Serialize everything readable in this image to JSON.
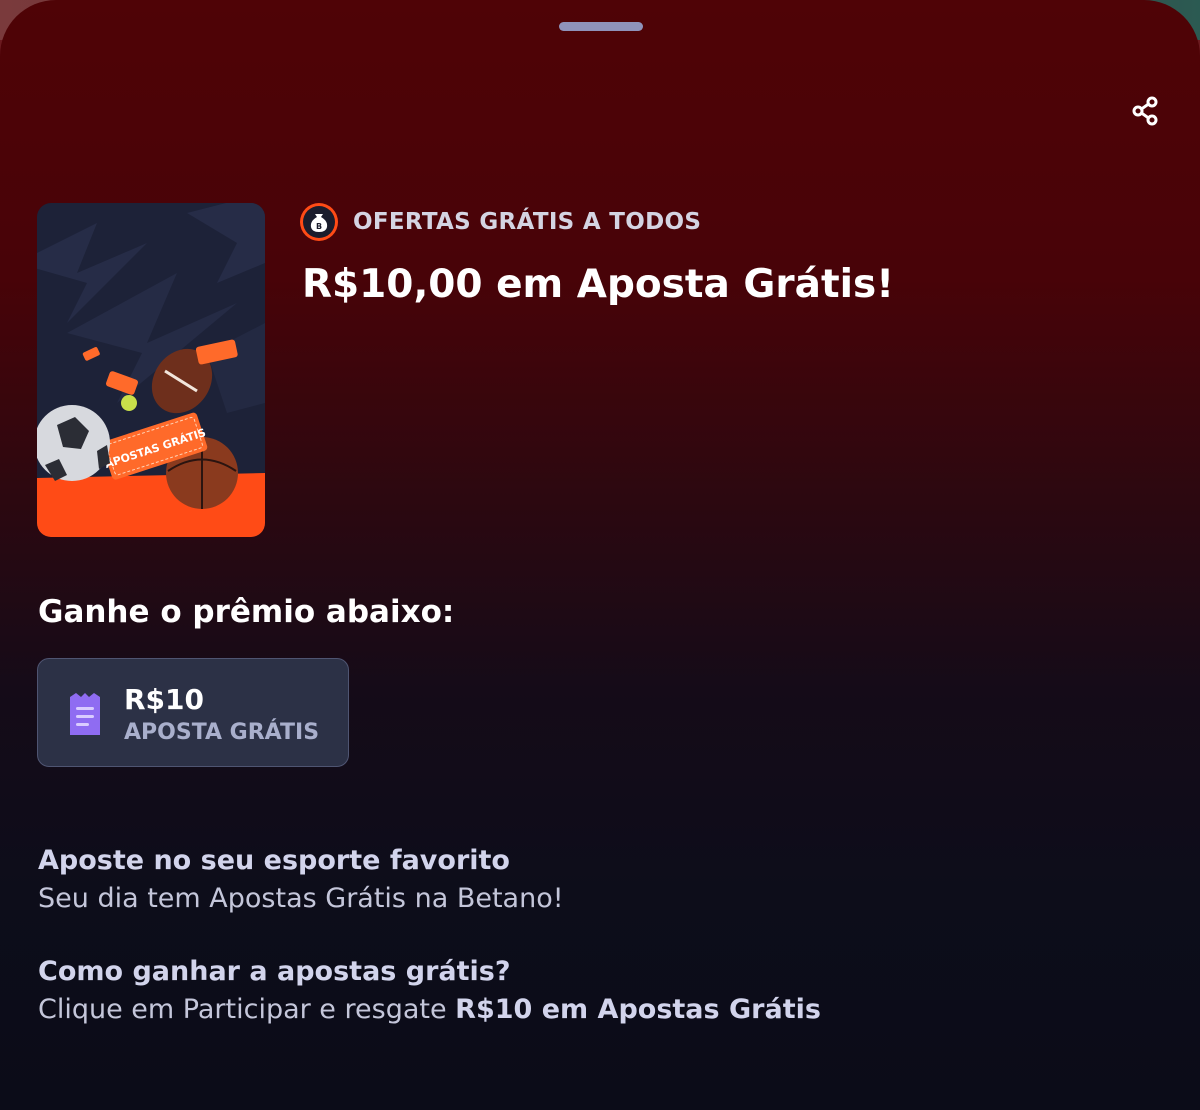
{
  "header": {
    "share_icon": "share-icon"
  },
  "offer": {
    "category_icon": "money-bag-icon",
    "category_label": "OFERTAS GRÁTIS A TODOS",
    "title": "R$10,00 em Aposta Grátis!",
    "image_caption": "APOSTAS GRÁTIS"
  },
  "prize": {
    "heading": "Ganhe o prêmio abaixo:",
    "icon": "bet-slip-icon",
    "amount": "R$10",
    "type": "APOSTA GRÁTIS"
  },
  "info": [
    {
      "title": "Aposte no seu esporte favorito",
      "text": "Seu dia tem Apostas Grátis na Betano!"
    },
    {
      "title": "Como ganhar a apostas grátis?",
      "text_prefix": "Clique em Participar e resgate ",
      "text_bold": "R$10 em Apostas Grátis"
    }
  ],
  "colors": {
    "accent_orange": "#ff4b16",
    "prize_icon_purple": "#8f6cf2",
    "card_background": "#2c3146"
  }
}
